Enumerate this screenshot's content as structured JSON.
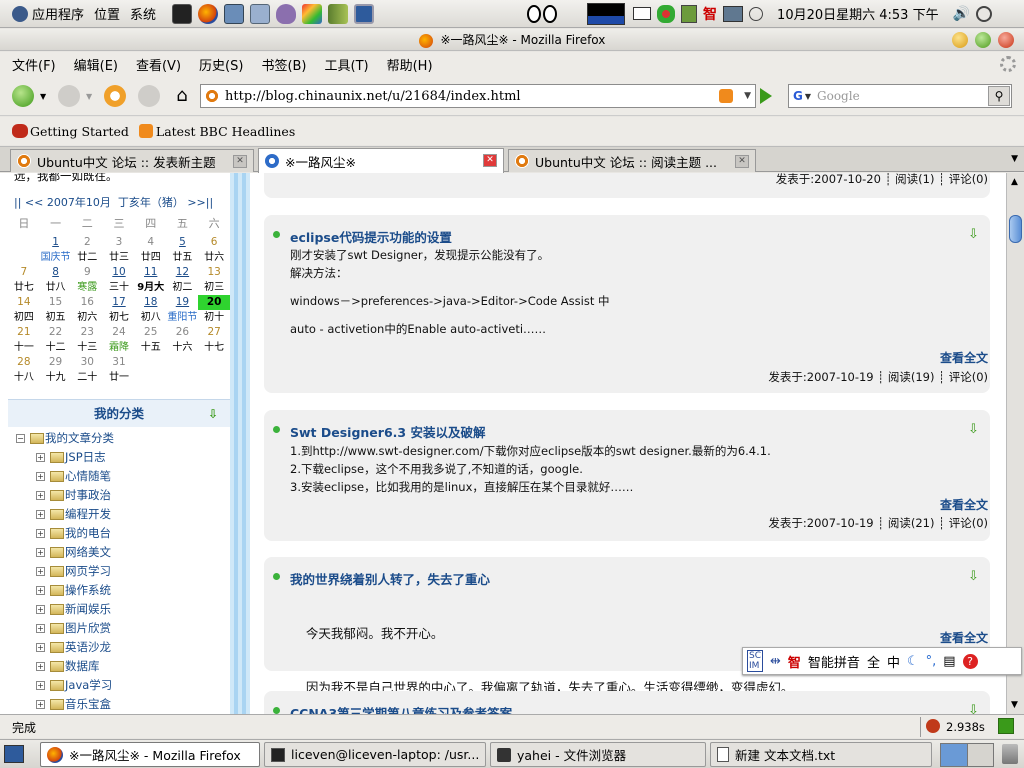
{
  "top_panel": {
    "menus": [
      "应用程序",
      "位置",
      "系统"
    ],
    "clock": "10月20日星期六  4:53 下午"
  },
  "window": {
    "title": "※一路风尘※ - Mozilla Firefox"
  },
  "menubar": [
    "文件(F)",
    "编辑(E)",
    "查看(V)",
    "历史(S)",
    "书签(B)",
    "工具(T)",
    "帮助(H)"
  ],
  "nav": {
    "url": "http://blog.chinaunix.net/u/21684/index.html",
    "search_placeholder": "Google"
  },
  "bookmarks": [
    "Getting Started",
    "Latest BBC Headlines"
  ],
  "tabs": [
    {
      "label": "Ubuntu中文 论坛 :: 发表新主题"
    },
    {
      "label": "※一路风尘※"
    },
    {
      "label": "Ubuntu中文 论坛 :: 阅读主题 ..."
    }
  ],
  "sidebar": {
    "top_fragment": "远，我都一如既往。",
    "calendar_nav": "|| << 2007年10月  丁亥年（猪） >>||",
    "weekdays": [
      "日",
      "一",
      "二",
      "三",
      "四",
      "五",
      "六"
    ],
    "category_title": "我的分类",
    "tree_root": "我的文章分类",
    "categories": [
      "JSP日志",
      "心情随笔",
      "时事政治",
      "编程开发",
      "我的电台",
      "网络美文",
      "网页学习",
      "操作系统",
      "新闻娱乐",
      "图片欣赏",
      "英语沙龙",
      "数据库",
      "Java学习",
      "音乐宝盒"
    ]
  },
  "calendar_rows": [
    [
      {
        "d": "",
        "l": ""
      },
      {
        "d": "1",
        "l": "国庆节",
        "c": "#1b4c8a"
      },
      {
        "d": "2",
        "l": "廿二",
        "c": "#888"
      },
      {
        "d": "3",
        "l": "廿三",
        "c": "#888"
      },
      {
        "d": "4",
        "l": "廿四",
        "c": "#888"
      },
      {
        "d": "5",
        "l": "廿五",
        "c": "#1b4c8a"
      },
      {
        "d": "6",
        "l": "廿六",
        "c": "#b58a2a"
      }
    ],
    [
      {
        "d": "7",
        "l": "廿七",
        "c": "#b58a2a"
      },
      {
        "d": "8",
        "l": "廿八",
        "c": "#1b4c8a"
      },
      {
        "d": "9",
        "l": "寒露",
        "c": "#888"
      },
      {
        "d": "10",
        "l": "三十",
        "c": "#1b4c8a"
      },
      {
        "d": "11",
        "l": "9月大",
        "c": "#1b4c8a"
      },
      {
        "d": "12",
        "l": "初二",
        "c": "#1b4c8a"
      },
      {
        "d": "13",
        "l": "初三",
        "c": "#b58a2a"
      }
    ],
    [
      {
        "d": "14",
        "l": "初四",
        "c": "#b58a2a"
      },
      {
        "d": "15",
        "l": "初五",
        "c": "#888"
      },
      {
        "d": "16",
        "l": "初六",
        "c": "#888"
      },
      {
        "d": "17",
        "l": "初七",
        "c": "#1b4c8a"
      },
      {
        "d": "18",
        "l": "初八",
        "c": "#1b4c8a"
      },
      {
        "d": "19",
        "l": "重阳节",
        "c": "#1b4c8a"
      },
      {
        "d": "20",
        "l": "初十",
        "c": "#000"
      }
    ],
    [
      {
        "d": "21",
        "l": "十一",
        "c": "#b58a2a"
      },
      {
        "d": "22",
        "l": "十二",
        "c": "#888"
      },
      {
        "d": "23",
        "l": "十三",
        "c": "#888"
      },
      {
        "d": "24",
        "l": "霜降",
        "c": "#888"
      },
      {
        "d": "25",
        "l": "十五",
        "c": "#888"
      },
      {
        "d": "26",
        "l": "十六",
        "c": "#888"
      },
      {
        "d": "27",
        "l": "十七",
        "c": "#b58a2a"
      }
    ],
    [
      {
        "d": "28",
        "l": "十八",
        "c": "#b58a2a"
      },
      {
        "d": "29",
        "l": "十九",
        "c": "#888"
      },
      {
        "d": "30",
        "l": "二十",
        "c": "#888"
      },
      {
        "d": "31",
        "l": "廿一",
        "c": "#888"
      },
      {
        "d": "",
        "l": ""
      },
      {
        "d": "",
        "l": ""
      },
      {
        "d": "",
        "l": ""
      }
    ]
  ],
  "posts": {
    "first_meta": "发表于:2007-10-20 ┊ 阅读(1) ┊ 评论(0)",
    "p1": {
      "title": "eclipse代码提示功能的设置",
      "lines": [
        "刚才安装了swt Designer，发现提示公能没有了。",
        "解决方法：",
        "",
        "windows－>preferences->java->Editor->Code   Assist   中",
        "",
        "auto - activetion中的Enable auto-activeti……"
      ],
      "more": "查看全文",
      "meta": "发表于:2007-10-19 ┊ 阅读(19) ┊ 评论(0)"
    },
    "p2": {
      "title": "Swt Designer6.3 安装以及破解",
      "lines": [
        "1.到http://www.swt-designer.com/下载你对应eclipse版本的swt designer.最新的为6.4.1.",
        "2.下载eclipse，这个不用我多说了,不知道的话，google.",
        "3.安装eclipse，比如我用的是linux，直接解压在某个目录就好……"
      ],
      "more": "查看全文",
      "meta": "发表于:2007-10-19 ┊ 阅读(21) ┊ 评论(0)"
    },
    "p3": {
      "title": "我的世界绕着别人转了，失去了重心",
      "lines": [
        "    今天我郁闷。我不开心。",
        "    因为我不是自己世界的中心了。我偏离了轨道，失去了重心。生活变得缥缈，变得虚幻。"
      ],
      "more": "查看全文"
    },
    "p4": {
      "title": "CCNA3第三学期第八章练习及参考答案"
    }
  },
  "status": {
    "text": "完成",
    "timer": "2.938s"
  },
  "ime": {
    "name": "智能拼音",
    "full": "全",
    "zh": "中",
    "punct": "°,"
  },
  "taskbar": [
    {
      "label": "※一路风尘※ - Mozilla Firefox"
    },
    {
      "label": "liceven@liceven-laptop: /usr..."
    },
    {
      "label": "yahei - 文件浏览器"
    },
    {
      "label": "新建 文本文档.txt"
    }
  ]
}
